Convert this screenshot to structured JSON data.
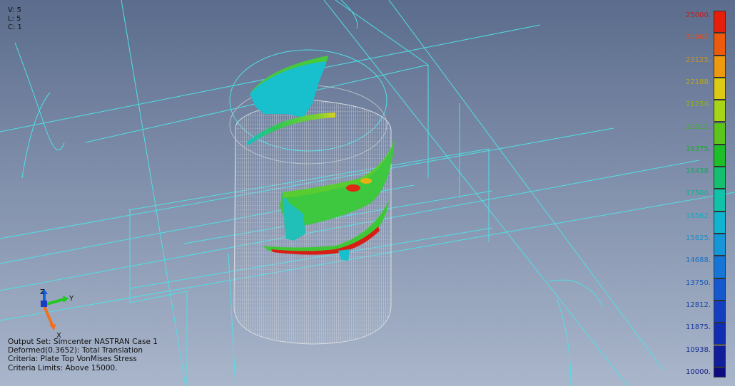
{
  "view_info": {
    "v": "V: 5",
    "l": "L: 5",
    "c": "C: 1"
  },
  "output_info": {
    "line1": "Output Set: Simcenter NASTRAN Case 1",
    "line2": "Deformed(0.3652): Total Translation",
    "line3": "Criteria: Plate Top VonMises Stress",
    "line4": "Criteria Limits: Above 15000."
  },
  "legend": {
    "entries": [
      {
        "label": "25000.",
        "color": "#e61e0a",
        "text_color": "#d01818"
      },
      {
        "label": "24062.",
        "color": "#ee5a0c",
        "text_color": "#e05020"
      },
      {
        "label": "23125.",
        "color": "#ee9a10",
        "text_color": "#c89020"
      },
      {
        "label": "22188.",
        "color": "#dcca14",
        "text_color": "#b8a818"
      },
      {
        "label": "21250.",
        "color": "#a8d418",
        "text_color": "#90b020"
      },
      {
        "label": "20312.",
        "color": "#5cc41c",
        "text_color": "#40b028"
      },
      {
        "label": "19375.",
        "color": "#1ebe28",
        "text_color": "#20a830"
      },
      {
        "label": "18438.",
        "color": "#14c070",
        "text_color": "#18a860"
      },
      {
        "label": "17500.",
        "color": "#10c2aa",
        "text_color": "#10b090"
      },
      {
        "label": "16562.",
        "color": "#10b4ce",
        "text_color": "#18a8c0"
      },
      {
        "label": "15625.",
        "color": "#1496d8",
        "text_color": "#1890c8"
      },
      {
        "label": "14688.",
        "color": "#1676d8",
        "text_color": "#1870c0"
      },
      {
        "label": "13750.",
        "color": "#1658ce",
        "text_color": "#1858b8"
      },
      {
        "label": "12812.",
        "color": "#1440c0",
        "text_color": "#1846a8"
      },
      {
        "label": "11875.",
        "color": "#122eb0",
        "text_color": "#1838a0"
      },
      {
        "label": "10938.",
        "color": "#101e9a",
        "text_color": "#182c90"
      },
      {
        "label": "10000.",
        "color": "#0c0c80",
        "text_color": "#182080"
      }
    ]
  },
  "triad": {
    "x_label": "X",
    "y_label": "Y",
    "z_label": "Z"
  },
  "colors": {
    "wireframe": "#4fe0e6",
    "mesh": "#cfd3da",
    "model_green": "#3ec83c",
    "model_cyan": "#18c0c8"
  }
}
